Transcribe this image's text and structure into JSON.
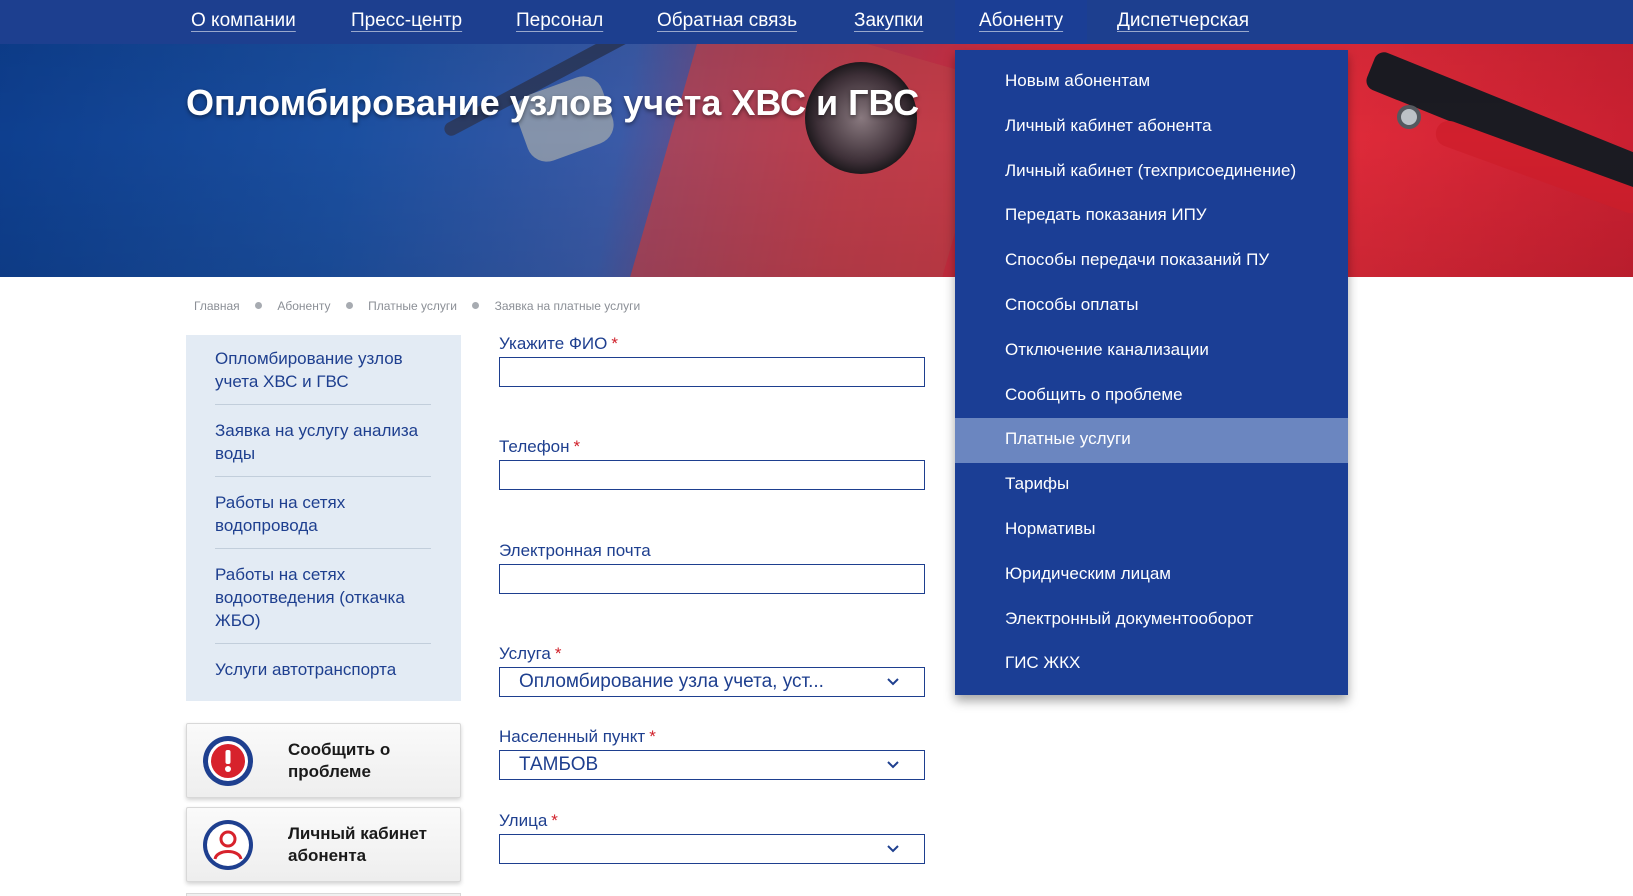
{
  "nav": {
    "items": [
      {
        "label": "О компании"
      },
      {
        "label": "Пресс-центр"
      },
      {
        "label": "Персонал"
      },
      {
        "label": "Обратная связь"
      },
      {
        "label": "Закупки"
      },
      {
        "label": "Абоненту"
      },
      {
        "label": "Диспетчерская"
      }
    ],
    "active": "Абоненту"
  },
  "hero": {
    "title": "Опломбирование узлов учета ХВС и ГВС"
  },
  "breadcrumb": [
    "Главная",
    "Абоненту",
    "Платные услуги",
    "Заявка на платные услуги"
  ],
  "sidebar": {
    "links": [
      "Опломбирование узлов учета ХВС и ГВС",
      "Заявка на услугу анализа воды",
      "Работы на сетях водопровода",
      "Работы на сетях водоотведения (откачка ЖБО)",
      "Услуги автотранспорта"
    ],
    "cards": [
      {
        "label": "Сообщить о проблеме",
        "icon": "alert-icon"
      },
      {
        "label": "Личный кабинет абонента",
        "icon": "user-icon"
      }
    ]
  },
  "form": {
    "required_mark": "*",
    "fio_label": "Укажите ФИО",
    "fio_value": "",
    "phone_label": "Телефон",
    "phone_value": "",
    "email_label": "Электронная почта",
    "email_value": "",
    "service_label": "Услуга",
    "service_value": "Опломбирование узла учета, уст...",
    "locality_label": "Населенный пункт",
    "locality_value": "ТАМБОВ",
    "street_label": "Улица",
    "street_value": ""
  },
  "dropdown": {
    "items": [
      "Новым абонентам",
      "Личный кабинет абонента",
      "Личный кабинет (техприсоединение)",
      "Передать показания ИПУ",
      "Способы передачи показаний ПУ",
      "Способы оплаты",
      "Отключение канализации",
      "Сообщить о проблеме",
      "Платные услуги",
      "Тарифы",
      "Нормативы",
      "Юридическим лицам",
      "Электронный документооборот",
      "ГИС ЖКХ"
    ],
    "highlighted": "Платные услуги"
  },
  "colors": {
    "nav_bg": "#1d3f8f",
    "dropdown_bg": "#1b3e95",
    "dropdown_highlight": "#6b86c0",
    "text_blue": "#1e3f8f",
    "required_red": "#d0202a",
    "sidebar_bg": "#e3ebf4"
  }
}
